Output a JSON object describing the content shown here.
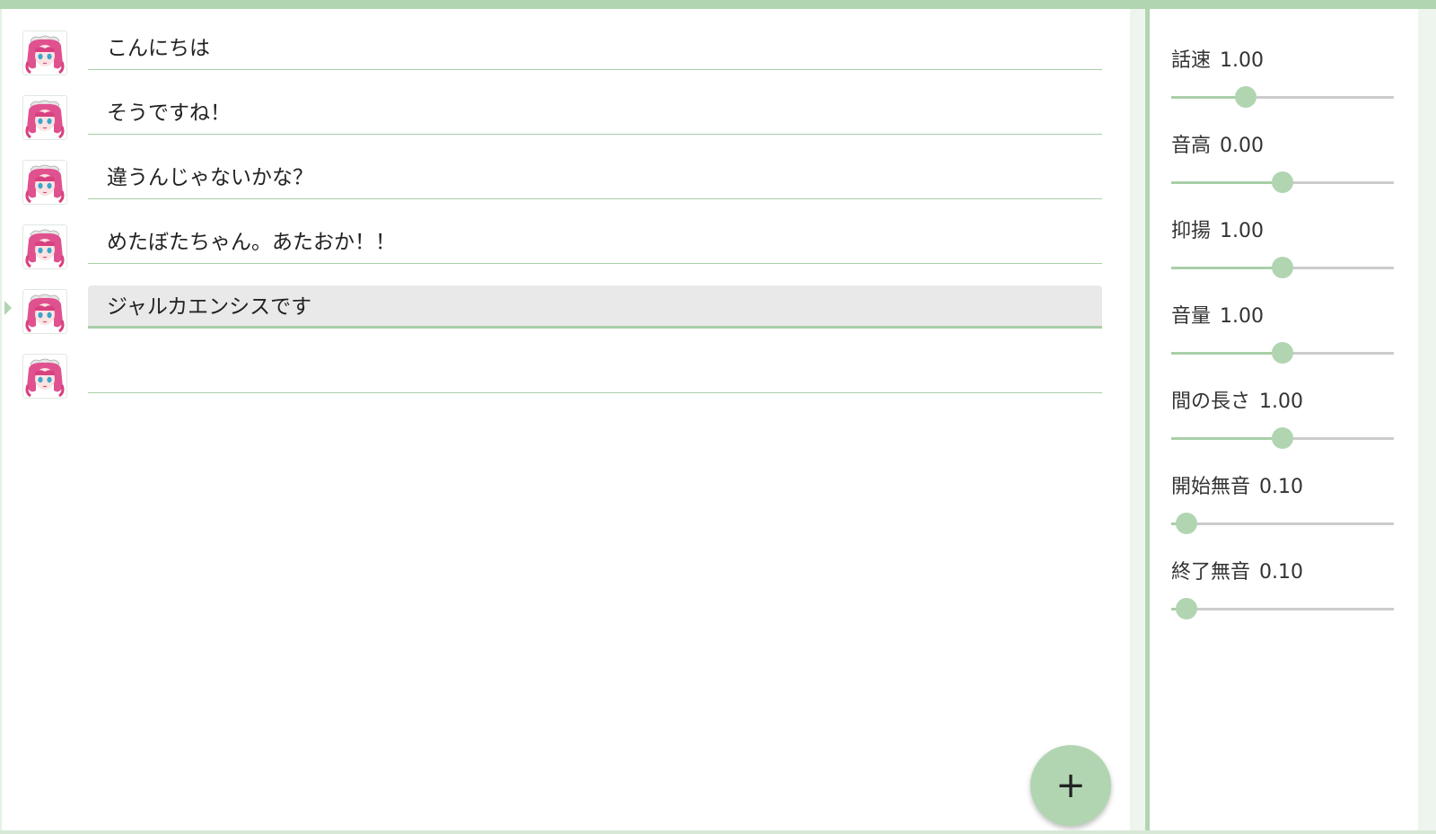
{
  "colors": {
    "accent": "#b1d5b1",
    "active_row_bg": "#e9e9e9"
  },
  "list": {
    "avatar_icon": "character-avatar-icon",
    "rows": [
      {
        "text": "こんにちは",
        "active": false
      },
      {
        "text": "そうですね！",
        "active": false
      },
      {
        "text": "違うんじゃないかな？",
        "active": false
      },
      {
        "text": "めたぼたちゃん。あたおか！！",
        "active": false
      },
      {
        "text": "ジャルカエンシスです",
        "active": true
      },
      {
        "text": "",
        "active": false
      }
    ]
  },
  "fab": {
    "label": "+",
    "icon": "plus-icon"
  },
  "params": [
    {
      "name": "話速",
      "value": "1.00",
      "position": 0.333
    },
    {
      "name": "音高",
      "value": "0.00",
      "position": 0.5
    },
    {
      "name": "抑揚",
      "value": "1.00",
      "position": 0.5
    },
    {
      "name": "音量",
      "value": "1.00",
      "position": 0.5
    },
    {
      "name": "間の長さ",
      "value": "1.00",
      "position": 0.5
    },
    {
      "name": "開始無音",
      "value": "0.10",
      "position": 0.067
    },
    {
      "name": "終了無音",
      "value": "0.10",
      "position": 0.067
    }
  ]
}
